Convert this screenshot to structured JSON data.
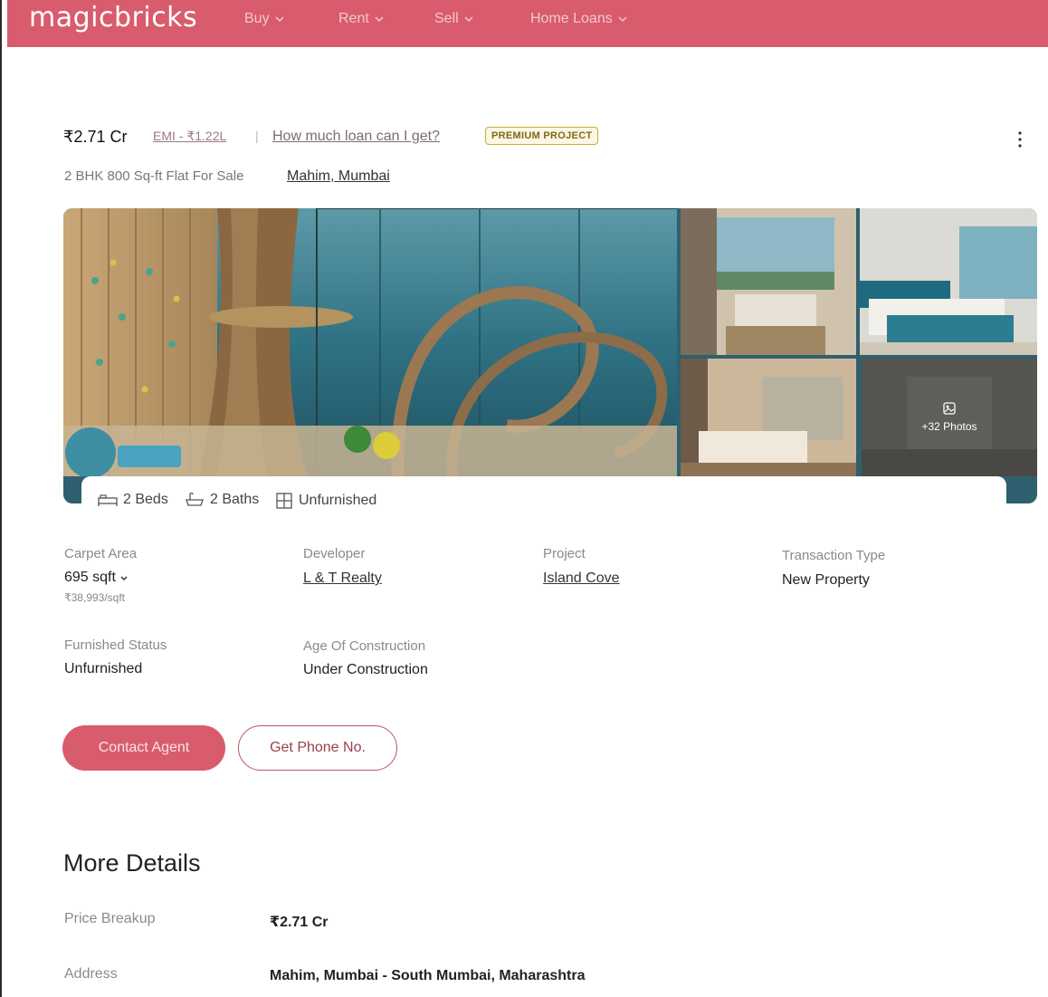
{
  "nav": {
    "logo": "magicbricks",
    "items": [
      {
        "label": "Buy"
      },
      {
        "label": "Rent"
      },
      {
        "label": "Sell"
      },
      {
        "label": "Home Loans"
      }
    ],
    "color": "#d85c6d"
  },
  "header": {
    "price": "₹2.71 Cr",
    "emi": "EMI - ₹1.22L",
    "separator": "|",
    "loan_link": "How much loan can I get?",
    "badge": "PREMIUM PROJECT",
    "menu_icon": "kebab-icon"
  },
  "subtitle": {
    "text": "2 BHK 800 Sq-ft Flat For Sale",
    "locality": "Mahim, Mumbai"
  },
  "gallery": {
    "photo_count": "+32 Photos",
    "photo_icon": "image-icon"
  },
  "features": [
    {
      "icon": "bed-icon",
      "label": "2 Beds"
    },
    {
      "icon": "bath-icon",
      "label": "2 Baths"
    },
    {
      "icon": "furnishing-icon",
      "label": "Unfurnished"
    }
  ],
  "specs": {
    "carpet_area": {
      "label": "Carpet Area",
      "value": "695 sqft",
      "sub": "₹38,993/sqft"
    },
    "developer": {
      "label": "Developer",
      "value": "L & T Realty"
    },
    "project": {
      "label": "Project",
      "value": "Island Cove"
    },
    "transaction": {
      "label": "Transaction Type",
      "value": "New Property"
    },
    "furnished": {
      "label": "Furnished Status",
      "value": "Unfurnished"
    },
    "age": {
      "label": "Age Of Construction",
      "value": "Under Construction"
    }
  },
  "actions": {
    "contact": "Contact Agent",
    "phone": "Get Phone No."
  },
  "more_details": {
    "title": "More Details",
    "rows": [
      {
        "label": "Price Breakup",
        "value": "₹2.71 Cr"
      },
      {
        "label": "Address",
        "value": "Mahim, Mumbai - South Mumbai, Maharashtra"
      }
    ]
  }
}
